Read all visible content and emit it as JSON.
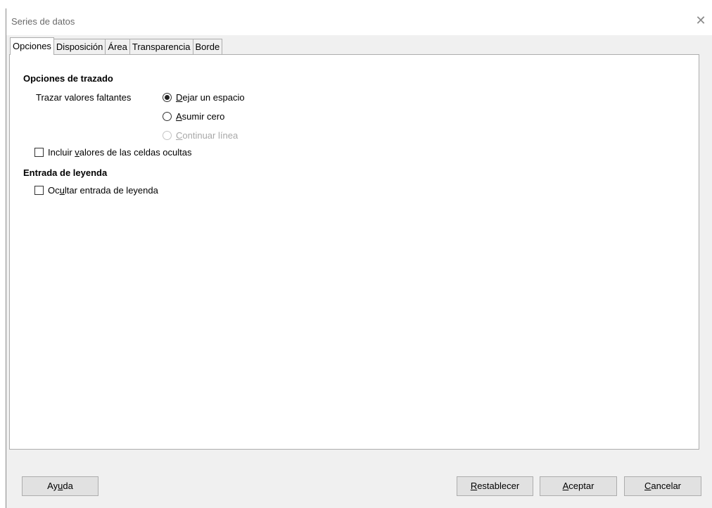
{
  "window": {
    "title": "Series de datos"
  },
  "tabs": [
    {
      "label": "Opciones"
    },
    {
      "label": "Disposición"
    },
    {
      "label": "Área"
    },
    {
      "label": "Transparencia"
    },
    {
      "label": "Borde"
    }
  ],
  "options_section": {
    "title": "Opciones de trazado",
    "missing_values_label": "Trazar valores faltantes",
    "radios": [
      {
        "mn": "D",
        "rest": "ejar un espacio",
        "checked": true,
        "enabled": true
      },
      {
        "mn": "A",
        "rest": "sumir cero",
        "checked": false,
        "enabled": true
      },
      {
        "mn": "C",
        "rest": "ontinuar línea",
        "checked": false,
        "enabled": false
      }
    ],
    "hidden_cells": {
      "pre": "Incluir ",
      "mn": "v",
      "rest": "alores de las celdas ocultas",
      "checked": false
    }
  },
  "legend_section": {
    "title": "Entrada de leyenda",
    "hide_entry": {
      "pre": "Oc",
      "mn": "u",
      "rest": "ltar entrada de leyenda",
      "checked": false
    }
  },
  "buttons": {
    "help": {
      "pre": "Ay",
      "mn": "u",
      "rest": "da"
    },
    "reset": {
      "pre": "",
      "mn": "R",
      "rest": "establecer"
    },
    "ok": {
      "pre": "",
      "mn": "A",
      "rest": "ceptar"
    },
    "cancel": {
      "pre": "",
      "mn": "C",
      "rest": "ancelar"
    }
  }
}
